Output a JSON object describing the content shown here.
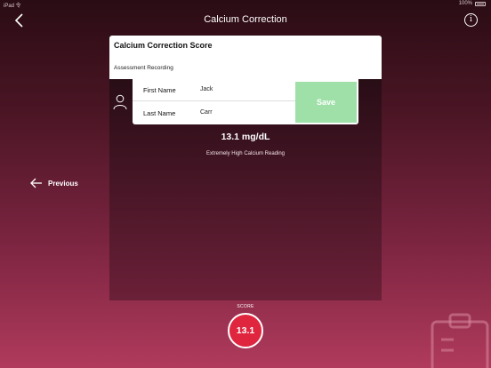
{
  "status_bar": {
    "carrier": "iPad 令",
    "battery": "100%"
  },
  "nav": {
    "title": "Calcium Correction",
    "back_icon": "chevron-left-icon",
    "info_icon": "info-icon",
    "info_glyph": "i"
  },
  "score_card": {
    "title": "Calcium Correction Score",
    "subtitle": "Assessment Recording"
  },
  "form": {
    "first_name_label": "First Name",
    "first_name_value": "Jack",
    "last_name_label": "Last Name",
    "last_name_value": "Carr",
    "save_label": "Save"
  },
  "result": {
    "value": "13.1 mg/dL",
    "description": "Extremely High Calcium Reading"
  },
  "navigation": {
    "previous_label": "Previous"
  },
  "score": {
    "label": "SCORE",
    "value": "13.1"
  },
  "colors": {
    "accent_red": "#e0253e",
    "save_green": "#9fe0a8",
    "bg_top": "#2a0c14",
    "bg_bottom": "#b03a5c"
  }
}
